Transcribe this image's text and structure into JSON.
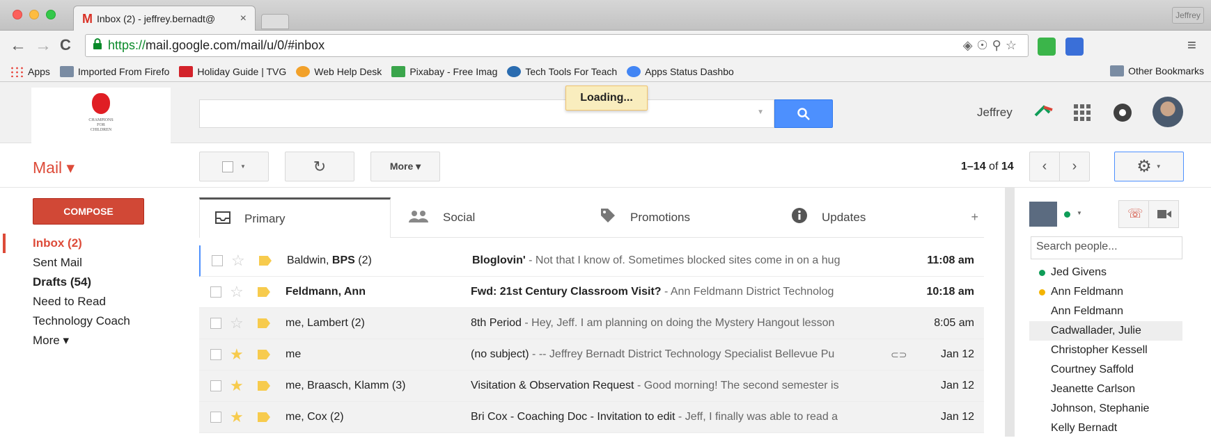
{
  "browser": {
    "tab_title": "Inbox (2) - jeffrey.bernadt@",
    "tab_close": "×",
    "profile_name": "Jeffrey",
    "url_scheme": "https://",
    "url_rest": "mail.google.com/mail/u/0/#inbox",
    "bookmarks": [
      {
        "label": "Apps",
        "icon": "apps-grid-icon",
        "color": "#e8453c"
      },
      {
        "label": "Imported From Firefo",
        "icon": "folder-icon",
        "color": "#7a8ca3"
      },
      {
        "label": "Holiday Guide | TVG",
        "icon": "tvguide-icon",
        "color": "#d3222a"
      },
      {
        "label": "Web Help Desk",
        "icon": "webhelpdesk-icon",
        "color": "#f2a12a"
      },
      {
        "label": "Pixabay - Free Imag",
        "icon": "pixabay-icon",
        "color": "#3aa54b"
      },
      {
        "label": "Tech Tools For Teach",
        "icon": "wordpress-icon",
        "color": "#2a6cb0"
      },
      {
        "label": "Apps Status Dashbo",
        "icon": "google-icon",
        "color": "#4285f4"
      }
    ],
    "other_bookmarks": "Other Bookmarks"
  },
  "header": {
    "logo_text": [
      "CHAMPIONS",
      "FOR",
      "CHILDREN"
    ],
    "loading": "Loading...",
    "user_name": "Jeffrey"
  },
  "mailbar": {
    "mail_label": "Mail ▾",
    "more_label": "More ▾",
    "pager_range": "1–14",
    "pager_of": "of",
    "pager_total": "14"
  },
  "compose_label": "COMPOSE",
  "nav_items": [
    {
      "label": "Inbox (2)",
      "state": "active"
    },
    {
      "label": "Sent Mail",
      "state": ""
    },
    {
      "label": "Drafts (54)",
      "state": "bold"
    },
    {
      "label": "Need to Read",
      "state": ""
    },
    {
      "label": "Technology Coach",
      "state": ""
    },
    {
      "label": "More ▾",
      "state": ""
    }
  ],
  "tabs": [
    {
      "label": "Primary",
      "icon": "inbox-icon"
    },
    {
      "label": "Social",
      "icon": "people-icon"
    },
    {
      "label": "Promotions",
      "icon": "tag-icon"
    },
    {
      "label": "Updates",
      "icon": "info-icon"
    }
  ],
  "emails": [
    {
      "from_prefix": "Baldwin, ",
      "from_bold": "BPS",
      "from_suffix": " (2)",
      "subject": "Bloglovin'",
      "snippet": " - Not that I know of. Sometimes blocked sites come in on a hug",
      "date": "11:08 am",
      "starred": false,
      "unread": true,
      "attachment": false
    },
    {
      "from_prefix": "",
      "from_bold": "Feldmann, Ann",
      "from_suffix": "",
      "subject": "Fwd: 21st Century Classroom Visit?",
      "snippet": " - Ann Feldmann District Technolog",
      "date": "10:18 am",
      "starred": false,
      "unread": true,
      "attachment": false
    },
    {
      "from_prefix": "me, Lambert (2)",
      "from_bold": "",
      "from_suffix": "",
      "subject": "8th Period",
      "snippet": " - Hey, Jeff. I am planning on doing the Mystery Hangout lesson",
      "date": "8:05 am",
      "starred": false,
      "unread": false,
      "attachment": false
    },
    {
      "from_prefix": "me",
      "from_bold": "",
      "from_suffix": "",
      "subject": "(no subject)",
      "snippet": " - -- Jeffrey Bernadt District Technology Specialist Bellevue Pu",
      "date": "Jan 12",
      "starred": true,
      "unread": false,
      "attachment": true
    },
    {
      "from_prefix": "me, Braasch, Klamm (3)",
      "from_bold": "",
      "from_suffix": "",
      "subject": "Visitation & Observation Request",
      "snippet": " - Good morning! The second semester is",
      "date": "Jan 12",
      "starred": true,
      "unread": false,
      "attachment": false
    },
    {
      "from_prefix": "me, Cox (2)",
      "from_bold": "",
      "from_suffix": "",
      "subject": "Bri Cox - Coaching Doc - Invitation to edit",
      "snippet": " - Jeff, I finally was able to read a",
      "date": "Jan 12",
      "starred": true,
      "unread": false,
      "attachment": false
    }
  ],
  "chat": {
    "search_placeholder": "Search people...",
    "people": [
      {
        "name": "Jed Givens",
        "status": "#0f9d58"
      },
      {
        "name": "Ann Feldmann",
        "status": "#f4b400"
      },
      {
        "name": "Ann Feldmann",
        "status": ""
      },
      {
        "name": "Cadwallader, Julie",
        "status": ""
      },
      {
        "name": "Christopher Kessell",
        "status": ""
      },
      {
        "name": "Courtney Saffold",
        "status": ""
      },
      {
        "name": "Jeanette Carlson",
        "status": ""
      },
      {
        "name": "Johnson, Stephanie",
        "status": ""
      },
      {
        "name": "Kelly Bernadt",
        "status": ""
      }
    ]
  },
  "colors": {
    "accent_red": "#dd4b39",
    "search_blue": "#4d90fe",
    "star_yellow": "#f7cb4d"
  }
}
